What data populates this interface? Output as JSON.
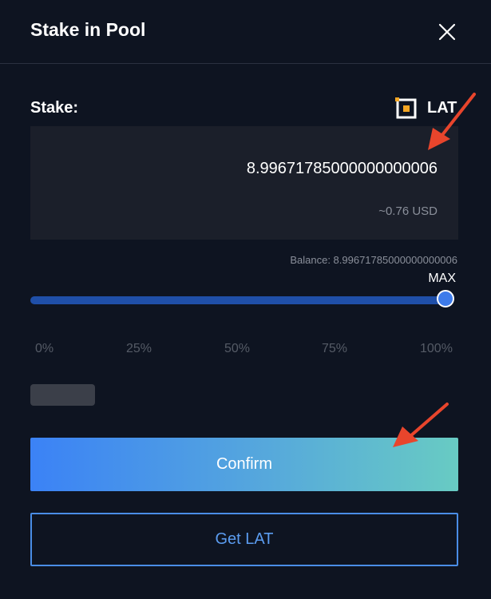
{
  "header": {
    "title": "Stake in Pool",
    "close_icon": "close-icon"
  },
  "stake": {
    "label": "Stake:",
    "token_icon": "lat-token-icon",
    "token_name": "LAT",
    "amount_value": "8.99671785000000000006",
    "usd_estimate": "~0.76 USD",
    "balance_text": "Balance: 8.99671785000000000006",
    "max_label": "MAX"
  },
  "slider": {
    "value_percent": 100,
    "marks": [
      "0%",
      "25%",
      "50%",
      "75%",
      "100%"
    ]
  },
  "buttons": {
    "confirm_label": "Confirm",
    "get_lat_label": "Get LAT"
  },
  "annotations": {
    "arrow_icon": "arrow-pointer-icon",
    "arrow_color": "#e8452c"
  },
  "colors": {
    "background": "#0e1421",
    "input_background": "#1b1f2a",
    "slider_track": "#1f4fa8",
    "slider_handle": "#3d7bea",
    "confirm_gradient_start": "#3b82f6",
    "confirm_gradient_end": "#68cbc3",
    "outline_button": "#4a8de6",
    "token_icon_accent": "#f5a623"
  }
}
